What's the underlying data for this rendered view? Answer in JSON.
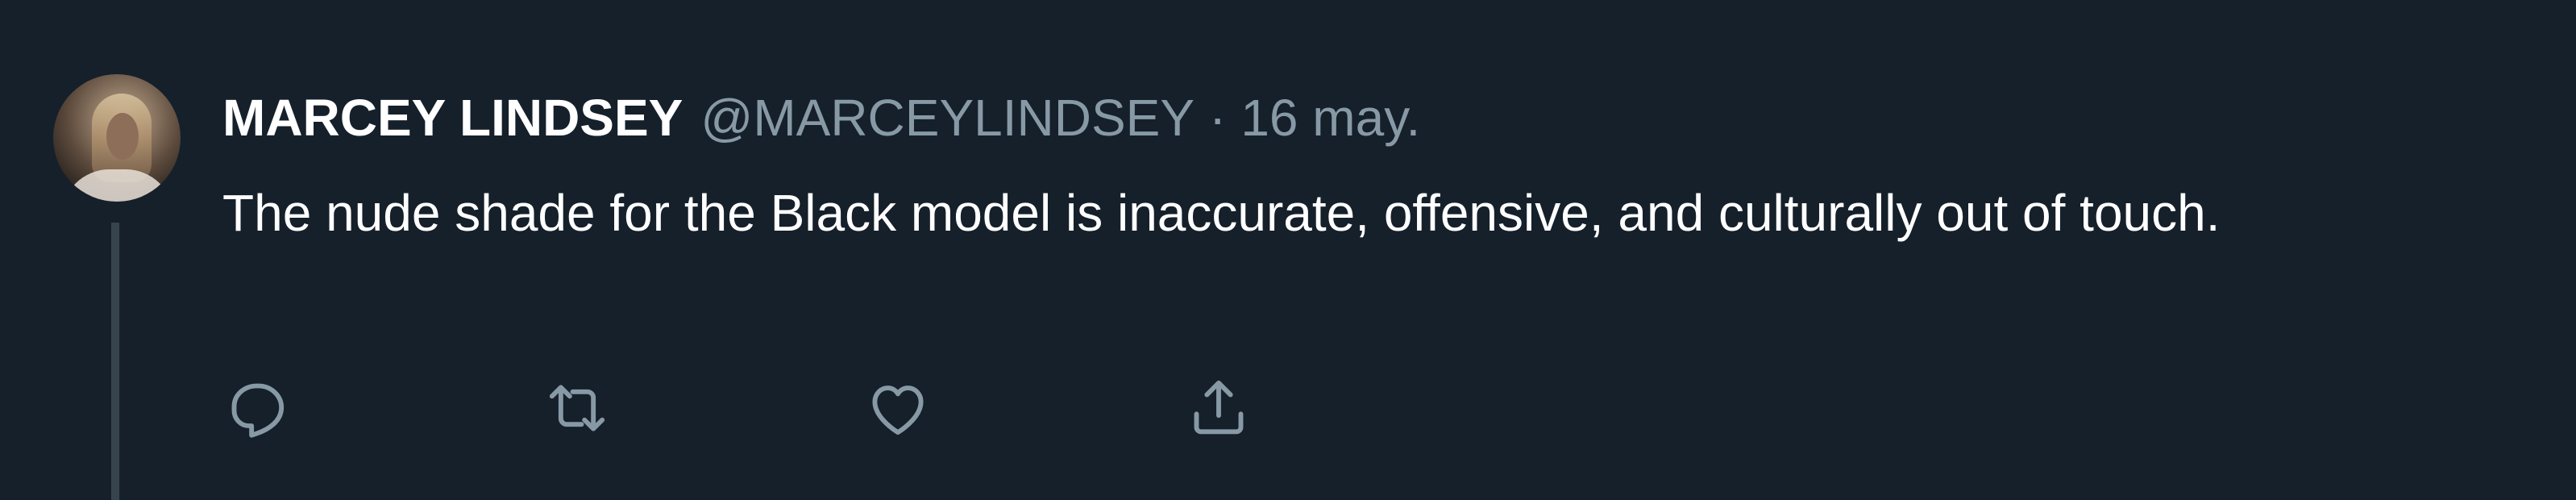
{
  "tweet": {
    "display_name": "MARCEY LINDSEY",
    "handle": "@MARCEYLINDSEY",
    "separator": "·",
    "date": "16 may.",
    "text": "The nude shade for the Black model is inaccurate, offensive, and culturally out of touch."
  },
  "actions": {
    "icons": [
      "reply-icon",
      "retweet-icon",
      "like-icon",
      "share-icon"
    ]
  },
  "colors": {
    "background": "#15202b",
    "primary_text": "#ffffff",
    "secondary_text": "#8899a6",
    "thread_line": "#38444d"
  }
}
